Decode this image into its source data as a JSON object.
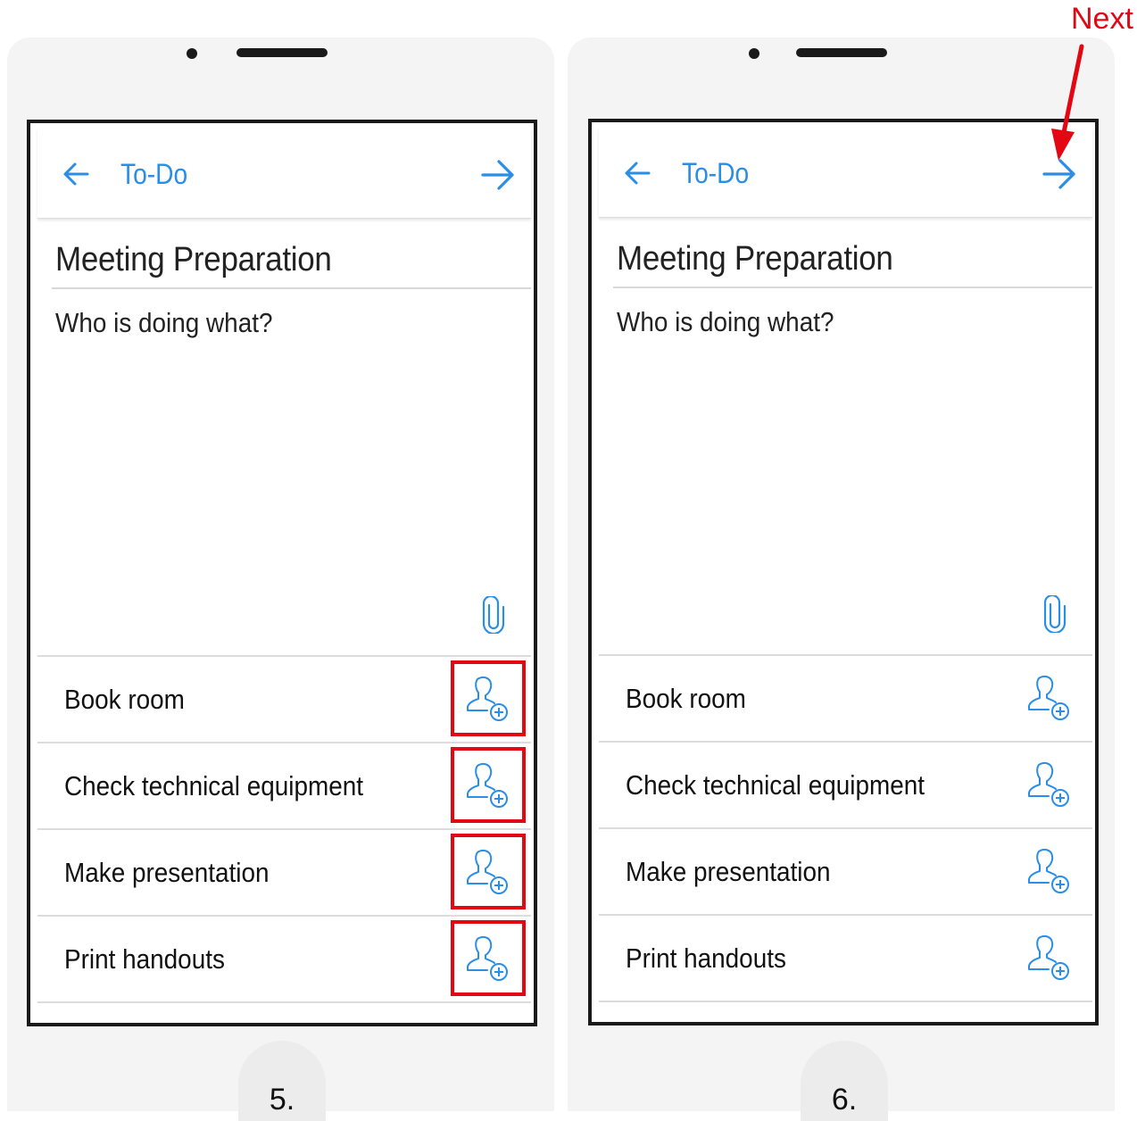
{
  "annotation": {
    "next_label": "Next",
    "highlight_color": "#e30613"
  },
  "accent_color": "#2b8ee6",
  "screens": [
    {
      "step": "5.",
      "header": {
        "back_icon": "arrow-left-icon",
        "title": "To-Do",
        "forward_icon": "arrow-right-icon"
      },
      "task_title": "Meeting Preparation",
      "description": "Who is doing what?",
      "attachment_icon": "paperclip-icon",
      "items": [
        {
          "label": "Book room",
          "icon": "add-person-icon",
          "highlighted": true
        },
        {
          "label": "Check technical equipment",
          "icon": "add-person-icon",
          "highlighted": true
        },
        {
          "label": "Make presentation",
          "icon": "add-person-icon",
          "highlighted": true
        },
        {
          "label": "Print handouts",
          "icon": "add-person-icon",
          "highlighted": true
        }
      ]
    },
    {
      "step": "6.",
      "header": {
        "back_icon": "arrow-left-icon",
        "title": "To-Do",
        "forward_icon": "arrow-right-icon"
      },
      "task_title": "Meeting Preparation",
      "description": "Who is doing what?",
      "attachment_icon": "paperclip-icon",
      "items": [
        {
          "label": "Book room",
          "icon": "add-person-icon",
          "highlighted": false
        },
        {
          "label": "Check technical equipment",
          "icon": "add-person-icon",
          "highlighted": false
        },
        {
          "label": "Make presentation",
          "icon": "add-person-icon",
          "highlighted": false
        },
        {
          "label": "Print handouts",
          "icon": "add-person-icon",
          "highlighted": false
        }
      ]
    }
  ]
}
